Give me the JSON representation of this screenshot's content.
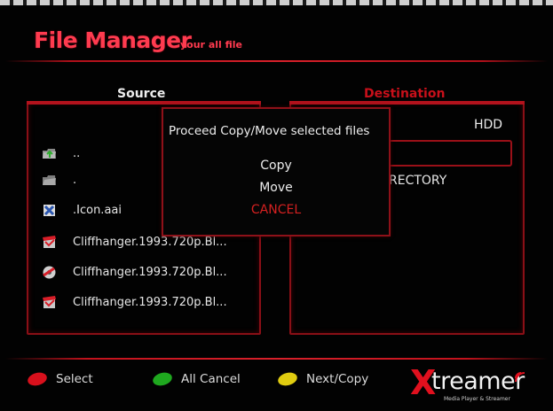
{
  "header": {
    "title": "File Manager",
    "subtitle": "your all file"
  },
  "source_panel": {
    "label": "Source",
    "files": [
      {
        "name": "..",
        "icon": "folder-up-icon"
      },
      {
        "name": ".",
        "icon": "folder-icon"
      },
      {
        "name": ".Icon.aai",
        "icon": "image-file-icon"
      },
      {
        "name": "Cliffhanger.1993.720p.Bl...",
        "icon": "video-file-icon"
      },
      {
        "name": "Cliffhanger.1993.720p.Bl...",
        "icon": "video-file-icon"
      },
      {
        "name": "Cliffhanger.1993.720p.Bl...",
        "icon": "video-file-icon"
      }
    ]
  },
  "destination_panel": {
    "label": "Destination",
    "drive": "HDD",
    "directory_text": "RECTORY"
  },
  "dialog": {
    "prompt": "Proceed Copy/Move selected files",
    "options": [
      "Copy",
      "Move",
      "CANCEL"
    ],
    "selected_index": 2
  },
  "footer": {
    "hints": [
      {
        "label": "Select",
        "color": "#d8101c",
        "icon": "red-button-icon"
      },
      {
        "label": "All Cancel",
        "color": "#1fa81f",
        "icon": "green-button-icon"
      },
      {
        "label": "Next/Copy",
        "color": "#e0cc10",
        "icon": "yellow-button-icon"
      }
    ]
  },
  "brand": {
    "x": "X",
    "name": "treamer",
    "tagline": "Media Player & Streamer"
  },
  "colors": {
    "accent": "#ff3b4f",
    "frame": "#b3121c",
    "cancel": "#d42020"
  }
}
